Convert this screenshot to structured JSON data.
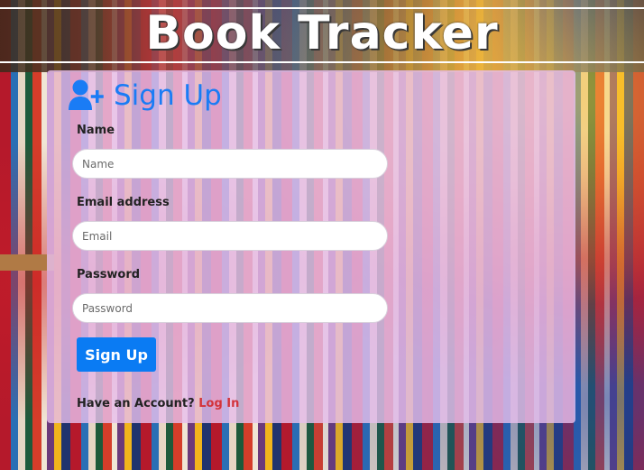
{
  "header": {
    "title": "Book Tracker"
  },
  "form": {
    "heading": "Sign Up",
    "heading_icon": "user-plus-icon",
    "name_label": "Name",
    "name_placeholder": "Name",
    "email_label": "Email address",
    "email_placeholder": "Email",
    "password_label": "Password",
    "password_placeholder": "Password",
    "submit_label": "Sign Up",
    "have_account_text": "Have an Account?",
    "login_link": "Log In"
  },
  "colors": {
    "accent": "#0a7bf3",
    "heading": "#1a7cf5",
    "link": "#d2333b",
    "card_bg": "#e6beeb"
  }
}
